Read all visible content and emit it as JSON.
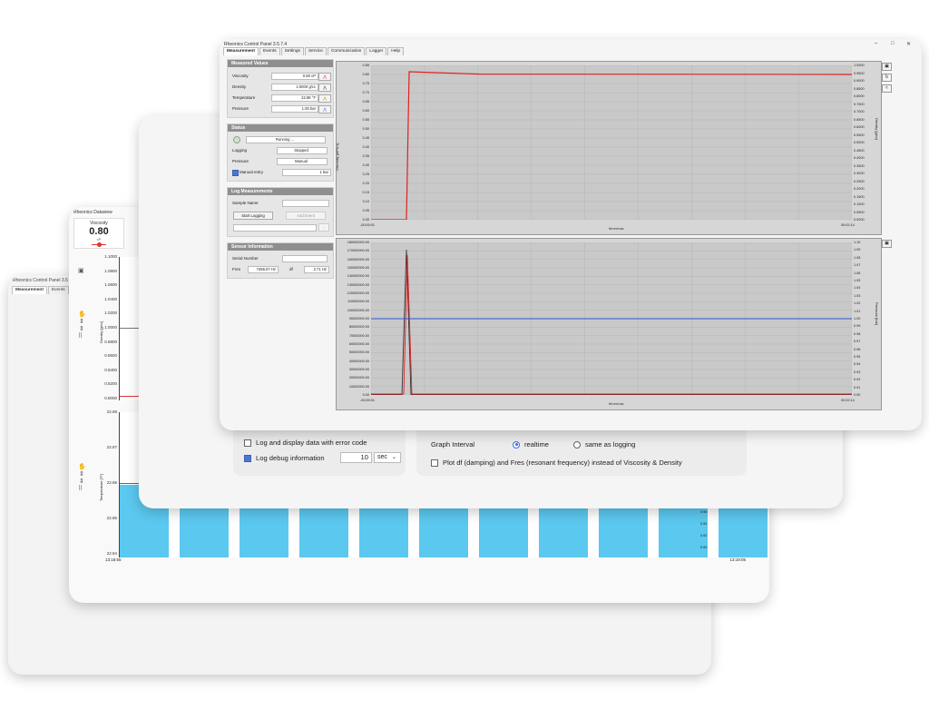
{
  "back1": {
    "title": "Rheonics Control Panel 3.5",
    "tabs": [
      "Measurement",
      "Events",
      "S"
    ]
  },
  "back2": {
    "title": "Rheonics Dataview",
    "viscosity_label": "Viscosity",
    "viscosity_value": "0.80",
    "viscosity_unit": "cP",
    "density_axis_label": "Density [g/cc]",
    "density_ticks": [
      "1.1000",
      "1.0800",
      "1.0600",
      "1.0400",
      "1.0200",
      "1.0000",
      "0.8800",
      "0.8600",
      "0.8400",
      "0.8200",
      "0.8000"
    ],
    "temp_axis_label": "Temperature [°F]",
    "temp_ticks": [
      "22.88",
      "22.87",
      "22.86",
      "22.85",
      "22.84"
    ],
    "time_start": "13:18:55",
    "time_end": "13:19:05",
    "right_ticks": [
      "0.96",
      "0.94",
      "0.92",
      "0.90"
    ]
  },
  "settings": {
    "log_error_label": "Log and display data with error code",
    "log_debug_label": "Log debug information",
    "log_debug_value": "10",
    "log_debug_unit": "sec",
    "graph_interval_label": "Graph Interval",
    "radio_realtime": "realtime",
    "radio_same": "same as logging",
    "plot_df_label": "Plot df (damping) and Fres (resonant frequency) instead of Viscosity & Density"
  },
  "front": {
    "title": "Rheonics Control Panel 3.5.7.4",
    "tabs": [
      "Measurement",
      "Events",
      "Settings",
      "Service",
      "Communication",
      "Logger",
      "Help"
    ],
    "measured": {
      "header": "Measured Values",
      "rows": [
        {
          "label": "Viscosity",
          "value": "0.80 cP"
        },
        {
          "label": "Density",
          "value": "1.0000 g/cc"
        },
        {
          "label": "Temperature",
          "value": "22.88 °F"
        },
        {
          "label": "Pressure",
          "value": "1.00 bar"
        }
      ]
    },
    "status": {
      "header": "Status",
      "running": "Running ...",
      "logging_label": "Logging",
      "logging_value": "Stopped",
      "pressure_label": "Pressure",
      "pressure_value": "Manual",
      "manual_entry_label": "Manual entry",
      "manual_entry_value": "1 bar"
    },
    "log": {
      "header": "Log Measurements",
      "sample_name_label": "Sample Name",
      "start_logging": "Start Logging",
      "add_event": "Add Event"
    },
    "sensor": {
      "header": "Sensor Information",
      "serial_label": "Serial Number",
      "fres_label": "Fres",
      "fres_value": "7466.07 Hz",
      "df_label": "df",
      "df_value": "2.71 Hz"
    },
    "chart1": {
      "ylabel": "Viscosity [mPa.s]",
      "y2label": "Density [g/cc]",
      "xlabel": "hh:mm:ss",
      "x_start": "-00:00:01",
      "x_end": "00:02:14",
      "y_ticks": [
        "0.85",
        "0.80",
        "0.75",
        "0.70",
        "0.65",
        "0.60",
        "0.55",
        "0.50",
        "0.45",
        "0.40",
        "0.35",
        "0.30",
        "0.25",
        "0.20",
        "0.15",
        "0.10",
        "0.05",
        "0.00"
      ],
      "y2_ticks": [
        "1.0000",
        "0.9500",
        "0.9000",
        "0.8500",
        "0.8000",
        "0.7500",
        "0.7000",
        "0.6500",
        "0.6000",
        "0.5500",
        "0.5000",
        "0.4500",
        "0.4000",
        "0.3500",
        "0.3000",
        "0.2500",
        "0.2000",
        "0.1500",
        "0.1000",
        "0.0500",
        "0.0000"
      ]
    },
    "chart2": {
      "y2label": "Pressure [bar]",
      "xlabel": "hh:mm:ss",
      "x_start": "-00:00:01",
      "x_end": "00:02:14",
      "y_ticks": [
        "180000000.00",
        "170000000.00",
        "160000000.00",
        "150000000.00",
        "140000000.00",
        "130000000.00",
        "120000000.00",
        "110000000.00",
        "100000000.00",
        "90000000.00",
        "80000000.00",
        "70000000.00",
        "60000000.00",
        "50000000.00",
        "40000000.00",
        "30000000.00",
        "20000000.00",
        "10000000.00",
        "0.00"
      ],
      "y2_ticks": [
        "1.10",
        "1.09",
        "1.08",
        "1.07",
        "1.06",
        "1.05",
        "1.04",
        "1.03",
        "1.02",
        "1.01",
        "1.00",
        "0.99",
        "0.98",
        "0.97",
        "0.96",
        "0.95",
        "0.94",
        "0.93",
        "0.92",
        "0.91",
        "0.90"
      ]
    }
  },
  "colors": {
    "viscosity_line": "#e02020",
    "pressure_line": "#2a52d8",
    "temp_bar": "#5bc8ef"
  }
}
